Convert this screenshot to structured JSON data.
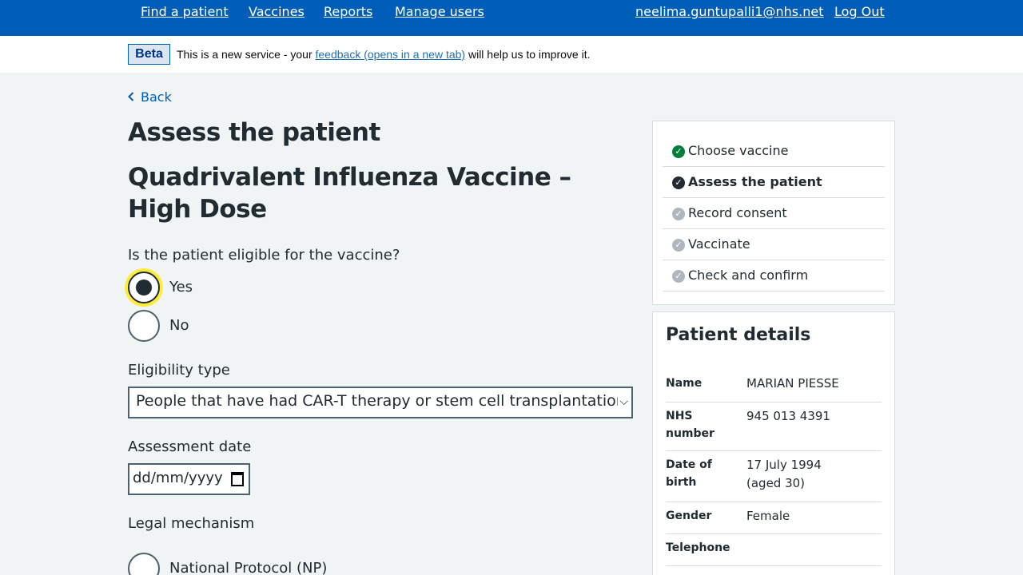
{
  "nav": {
    "find_patient": "Find a patient",
    "vaccines": "Vaccines",
    "reports": "Reports",
    "manage_users": "Manage users",
    "user_email": "neelima.guntupalli1@nhs.net",
    "logout": "Log Out"
  },
  "beta": {
    "tag": "Beta",
    "text_before": "This is a new service - your ",
    "link": "feedback (opens in a new tab)",
    "text_after": " will help us to improve it."
  },
  "back": "Back",
  "page_title": "Assess the patient",
  "vaccine_name": "Quadrivalent Influenza Vaccine – High Dose",
  "eligible": {
    "question": "Is the patient eligible for the vaccine?",
    "options": [
      "Yes",
      "No"
    ],
    "selected": "Yes"
  },
  "eligibility_type": {
    "label": "Eligibility type",
    "value": "People that have had CAR-T therapy or stem cell transplantation sir"
  },
  "assessment_date": {
    "label": "Assessment date",
    "placeholder": "dd/mm/yyyy"
  },
  "legal": {
    "label": "Legal mechanism",
    "option_np": "National Protocol (NP)"
  },
  "steps": [
    {
      "label": "Choose vaccine",
      "status": "complete"
    },
    {
      "label": "Assess the patient",
      "status": "current"
    },
    {
      "label": "Record consent",
      "status": "pending"
    },
    {
      "label": "Vaccinate",
      "status": "pending"
    },
    {
      "label": "Check and confirm",
      "status": "pending"
    }
  ],
  "patient": {
    "heading": "Patient details",
    "name_label": "Name",
    "name": "MARIAN PIESSE",
    "nhs_label": "NHS number",
    "nhs": "945 013 4391",
    "dob_label": "Date of birth",
    "dob": "17 July 1994",
    "age": "(aged 30)",
    "gender_label": "Gender",
    "gender": "Female",
    "tel_label": "Telephone",
    "tel": ""
  },
  "colors": {
    "nhs_blue": "#005eb8",
    "complete": "#007f3b",
    "current": "#212b32",
    "pending": "#aeb7bd",
    "focus": "#ffeb3b"
  }
}
